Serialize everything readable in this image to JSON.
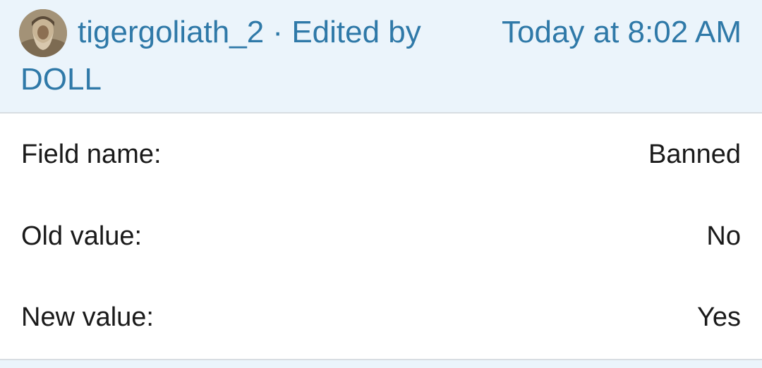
{
  "entry": {
    "author": "tigergoliath_2",
    "separator": " · ",
    "edited_by_label": "Edited by",
    "editor": "DOLL",
    "timestamp": "Today at 8:02 AM",
    "avatar_icon": "user-avatar-icon"
  },
  "changes": [
    {
      "label": "Field name:",
      "value": "Banned"
    },
    {
      "label": "Old value:",
      "value": "No"
    },
    {
      "label": "New value:",
      "value": "Yes"
    }
  ],
  "colors": {
    "header_bg": "#ebf4fb",
    "link": "#2f79a8",
    "text": "#1a1a1a",
    "divider": "#d8dde2"
  }
}
